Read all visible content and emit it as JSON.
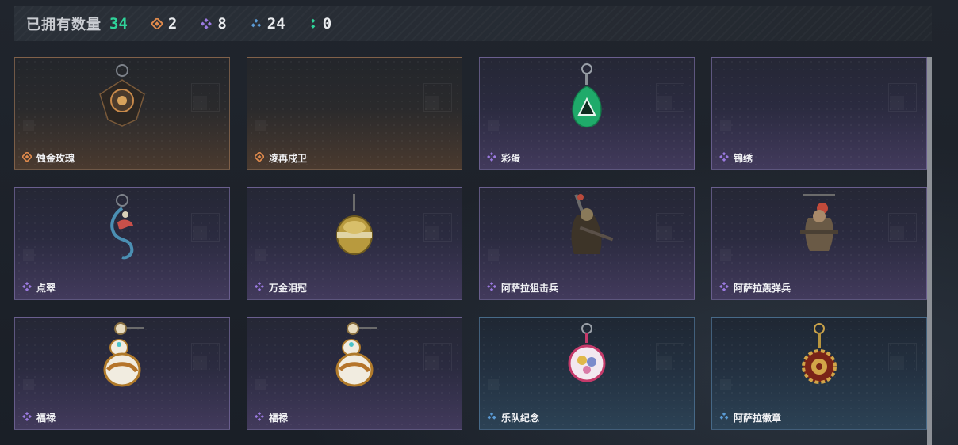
{
  "header": {
    "owned_label": "已拥有数量",
    "owned_count": "34",
    "rarity_counts": [
      {
        "icon": "orange-diamond-icon",
        "color": "#e08a4c",
        "value": "2"
      },
      {
        "icon": "purple-diamond-icon",
        "color": "#9b7ae0",
        "value": "8"
      },
      {
        "icon": "blue-diamond-icon",
        "color": "#5b9bd5",
        "value": "24"
      },
      {
        "icon": "green-dots-icon",
        "color": "#2fd49a",
        "value": "0"
      }
    ]
  },
  "items": [
    {
      "name": "蚀金玫瑰",
      "rarity": "orange",
      "art": "rose-pendant"
    },
    {
      "name": "凌再戍卫",
      "rarity": "orange",
      "art": "none"
    },
    {
      "name": "彩蛋",
      "rarity": "purple",
      "art": "green-triangle-tag"
    },
    {
      "name": "锦绣",
      "rarity": "purple",
      "art": "none"
    },
    {
      "name": "点翠",
      "rarity": "purple",
      "art": "phoenix-charm"
    },
    {
      "name": "万金泪冠",
      "rarity": "purple",
      "art": "golden-orb"
    },
    {
      "name": "阿萨拉狙击兵",
      "rarity": "purple",
      "art": "sniper-figure"
    },
    {
      "name": "阿萨拉轰弹兵",
      "rarity": "purple",
      "art": "grenadier-figure"
    },
    {
      "name": "福禄",
      "rarity": "purple",
      "art": "gourd-charm"
    },
    {
      "name": "福禄",
      "rarity": "purple",
      "art": "gourd-charm"
    },
    {
      "name": "乐队纪念",
      "rarity": "blue",
      "art": "band-badge"
    },
    {
      "name": "阿萨拉徽章",
      "rarity": "blue",
      "art": "asala-medal"
    }
  ],
  "colors": {
    "orange": "#e08a4c",
    "purple": "#9b7ae0",
    "blue": "#5b9bd5",
    "green": "#2fd49a"
  }
}
